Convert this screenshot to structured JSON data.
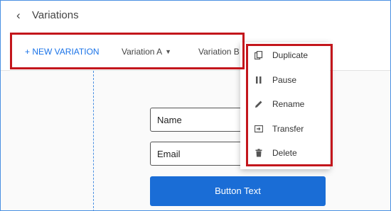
{
  "header": {
    "back_icon": "chevron-left-icon",
    "title": "Variations"
  },
  "tabs": {
    "new_variation": "+ NEW VARIATION",
    "variation_a": "Variation A",
    "variation_b": "Variation B"
  },
  "form": {
    "name_placeholder": "Name",
    "email_placeholder": "Email",
    "button_text": "Button Text"
  },
  "menu": {
    "items": [
      {
        "label": "Duplicate",
        "icon": "duplicate-icon"
      },
      {
        "label": "Pause",
        "icon": "pause-icon"
      },
      {
        "label": "Rename",
        "icon": "pencil-icon"
      },
      {
        "label": "Transfer",
        "icon": "transfer-icon"
      },
      {
        "label": "Delete",
        "icon": "trash-icon"
      }
    ]
  },
  "colors": {
    "accent": "#1a73e8",
    "button": "#1a6dd6",
    "highlight": "#c3161c"
  }
}
